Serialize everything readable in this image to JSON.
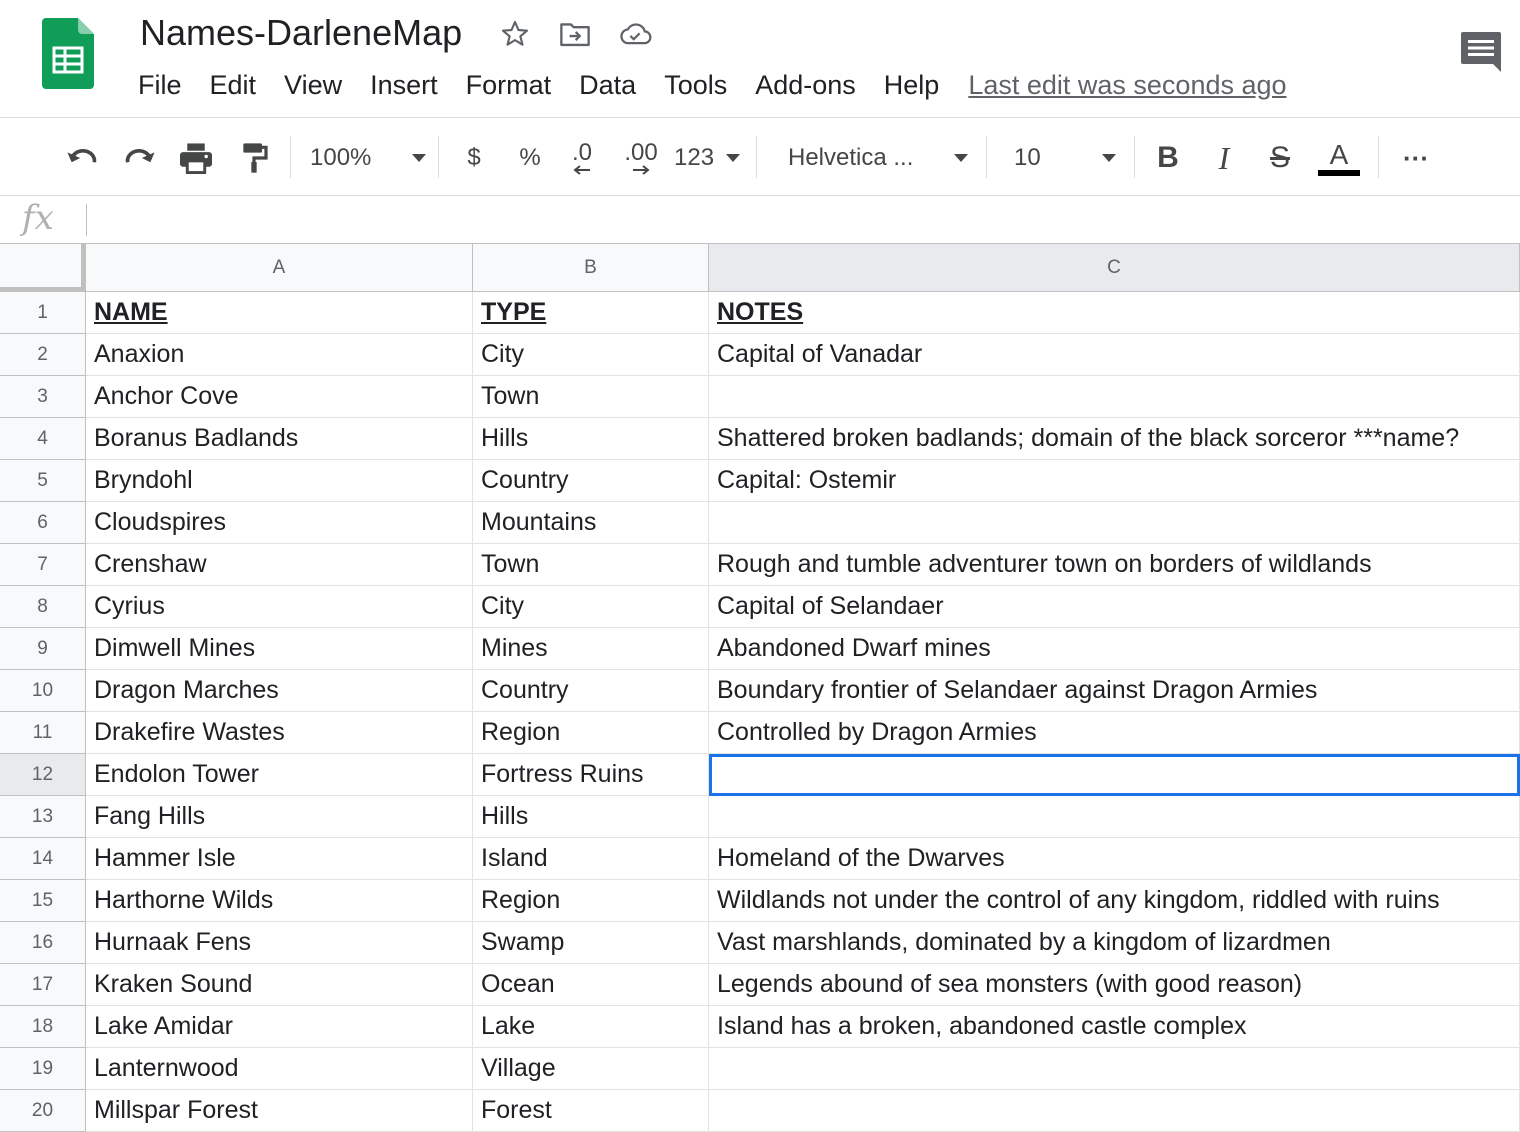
{
  "header": {
    "title": "Names-DarleneMap",
    "menu": [
      "File",
      "Edit",
      "View",
      "Insert",
      "Format",
      "Data",
      "Tools",
      "Add-ons",
      "Help"
    ],
    "last_edit": "Last edit was seconds ago"
  },
  "toolbar": {
    "zoom": "100%",
    "currency": "$",
    "percent": "%",
    "decrease_decimals": ".0",
    "increase_decimals": ".00",
    "number_format": "123",
    "font": "Helvetica ...",
    "font_size": "10",
    "bold": "B",
    "italic": "I",
    "strikethrough": "S",
    "text_color_label": "A",
    "more": "···"
  },
  "formula_bar": {
    "label": "fx",
    "value": ""
  },
  "grid": {
    "columns": [
      "A",
      "B",
      "C"
    ],
    "active_column": "C",
    "selected_cell": "C12",
    "header_row": {
      "num": "1",
      "cells": [
        "NAME",
        "TYPE",
        "NOTES"
      ]
    },
    "rows": [
      {
        "num": "2",
        "cells": [
          "Anaxion",
          "City",
          "Capital of Vanadar"
        ]
      },
      {
        "num": "3",
        "cells": [
          "Anchor Cove",
          "Town",
          ""
        ]
      },
      {
        "num": "4",
        "cells": [
          "Boranus Badlands",
          "Hills",
          "Shattered broken badlands; domain of the black sorceror ***name?"
        ]
      },
      {
        "num": "5",
        "cells": [
          "Bryndohl",
          "Country",
          "Capital: Ostemir"
        ]
      },
      {
        "num": "6",
        "cells": [
          "Cloudspires",
          "Mountains",
          ""
        ]
      },
      {
        "num": "7",
        "cells": [
          "Crenshaw",
          "Town",
          "Rough and tumble adventurer town on borders of wildlands"
        ]
      },
      {
        "num": "8",
        "cells": [
          "Cyrius",
          "City",
          "Capital of Selandaer"
        ]
      },
      {
        "num": "9",
        "cells": [
          "Dimwell Mines",
          "Mines",
          "Abandoned Dwarf mines"
        ]
      },
      {
        "num": "10",
        "cells": [
          "Dragon Marches",
          "Country",
          "Boundary frontier of Selandaer against Dragon Armies"
        ]
      },
      {
        "num": "11",
        "cells": [
          "Drakefire Wastes",
          "Region",
          "Controlled by Dragon Armies"
        ]
      },
      {
        "num": "12",
        "cells": [
          "Endolon Tower",
          "Fortress Ruins",
          ""
        ]
      },
      {
        "num": "13",
        "cells": [
          "Fang Hills",
          "Hills",
          ""
        ]
      },
      {
        "num": "14",
        "cells": [
          "Hammer Isle",
          "Island",
          "Homeland of the Dwarves"
        ]
      },
      {
        "num": "15",
        "cells": [
          "Harthorne Wilds",
          "Region",
          "Wildlands not under the control of any kingdom, riddled with ruins"
        ]
      },
      {
        "num": "16",
        "cells": [
          "Hurnaak Fens",
          "Swamp",
          "Vast marshlands, dominated by a kingdom of lizardmen"
        ]
      },
      {
        "num": "17",
        "cells": [
          "Kraken Sound",
          "Ocean",
          "Legends abound of sea monsters (with good reason)"
        ]
      },
      {
        "num": "18",
        "cells": [
          "Lake Amidar",
          "Lake",
          "Island has a broken, abandoned castle complex"
        ]
      },
      {
        "num": "19",
        "cells": [
          "Lanternwood",
          "Village",
          ""
        ]
      },
      {
        "num": "20",
        "cells": [
          "Millspar Forest",
          "Forest",
          ""
        ]
      }
    ]
  },
  "colors": {
    "sheets_green": "#0f9d58",
    "selection_blue": "#1a73e8",
    "header_bg": "#f8f9fa",
    "active_header_bg": "#e8eaed"
  },
  "icons": {
    "logo": "google-sheets-logo",
    "star": "star-icon",
    "move": "move-to-folder-icon",
    "cloud": "cloud-saved-icon",
    "comments": "comments-icon"
  }
}
